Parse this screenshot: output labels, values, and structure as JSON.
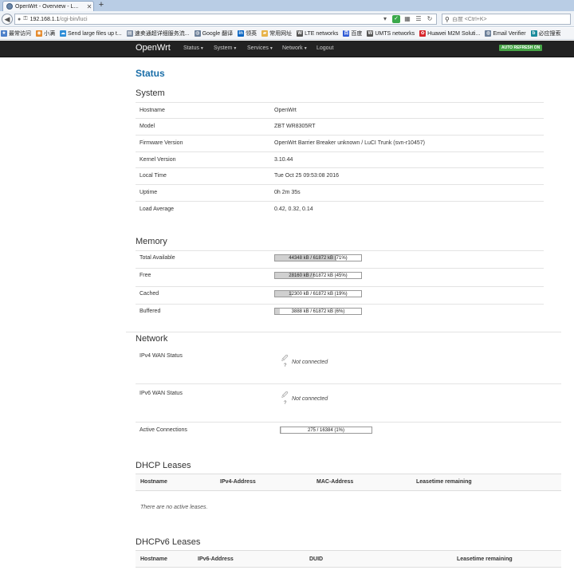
{
  "browser": {
    "tab_title": "OpenWrt - Overview - L...",
    "new_tab": "+",
    "url_host": "192.168.1.1",
    "url_path": "/cgi-bin/luci",
    "search_placeholder": "百度 <Ctrl+K>",
    "bookmarks": [
      {
        "label": "最常访问",
        "icon": "star-icon",
        "color": "#4a7ec9"
      },
      {
        "label": "小满",
        "icon": "bookmark-icon",
        "color": "#e58a2c"
      },
      {
        "label": "Send large files up t...",
        "icon": "cloud-icon",
        "color": "#2f8ed8"
      },
      {
        "label": "速卖通超详细服务流...",
        "icon": "page-icon",
        "color": "#7a8aa0"
      },
      {
        "label": "Google 翻译",
        "icon": "globe-icon",
        "color": "#6b7f99"
      },
      {
        "label": "领英",
        "icon": "linkedin-icon",
        "color": "#0a66c2"
      },
      {
        "label": "常用网址",
        "icon": "folder-icon",
        "color": "#e7b34a"
      },
      {
        "label": "LTE networks",
        "icon": "wikipedia-icon",
        "color": "#555555"
      },
      {
        "label": "百度",
        "icon": "baidu-icon",
        "color": "#2f5bd6"
      },
      {
        "label": "UMTS networks",
        "icon": "wikipedia-icon",
        "color": "#555555"
      },
      {
        "label": "Huawei M2M Soluti...",
        "icon": "huawei-icon",
        "color": "#d6252b"
      },
      {
        "label": "Email Verifier",
        "icon": "globe-icon",
        "color": "#6b7f99"
      },
      {
        "label": "必应搜索",
        "icon": "bing-icon",
        "color": "#198b9c"
      }
    ]
  },
  "header": {
    "brand": "OpenWrt",
    "menu": [
      "Status",
      "System",
      "Services",
      "Network",
      "Logout"
    ],
    "auto_refresh": "AUTO REFRESH ON",
    "accent": "#46a546"
  },
  "page_title": "Status",
  "system": {
    "title": "System",
    "rows": [
      {
        "label": "Hostname",
        "value": "OpenWrt"
      },
      {
        "label": "Model",
        "value": "ZBT WR8305RT"
      },
      {
        "label": "Firmware Version",
        "value": "OpenWrt Barrier Breaker unknown / LuCI Trunk (svn-r10457)"
      },
      {
        "label": "Kernel Version",
        "value": "3.10.44"
      },
      {
        "label": "Local Time",
        "value": "Tue Oct 25 09:53:08 2016"
      },
      {
        "label": "Uptime",
        "value": "0h 2m 35s"
      },
      {
        "label": "Load Average",
        "value": "0.42, 0.32, 0.14"
      }
    ]
  },
  "memory": {
    "title": "Memory",
    "rows": [
      {
        "label": "Total Available",
        "text": "44348 kB / 61872 kB (71%)",
        "percent": 71
      },
      {
        "label": "Free",
        "text": "28160 kB / 61872 kB (45%)",
        "percent": 45
      },
      {
        "label": "Cached",
        "text": "12300 kB / 61872 kB (19%)",
        "percent": 19
      },
      {
        "label": "Buffered",
        "text": "3888 kB / 61872 kB (6%)",
        "percent": 6
      }
    ]
  },
  "network": {
    "title": "Network",
    "ipv4_label": "IPv4 WAN Status",
    "ipv4_value": "Not connected",
    "ipv6_label": "IPv6 WAN Status",
    "ipv6_value": "Not connected",
    "unknown_mark": "?",
    "connections_label": "Active Connections",
    "connections_text": "275 / 16384 (1%)",
    "connections_percent": 1
  },
  "dhcp": {
    "title": "DHCP Leases",
    "headers": [
      "Hostname",
      "IPv4-Address",
      "MAC-Address",
      "Leasetime remaining"
    ],
    "empty": "There are no active leases."
  },
  "dhcp6": {
    "title": "DHCPv6 Leases",
    "headers": [
      "Hostname",
      "IPv6-Address",
      "DUID",
      "Leasetime remaining"
    ]
  }
}
